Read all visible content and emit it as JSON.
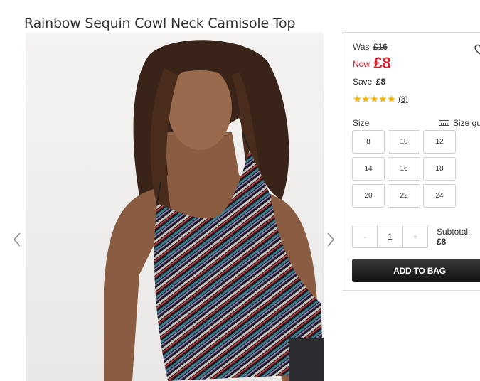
{
  "product": {
    "title": "Rainbow Sequin Cowl Neck Camisole Top"
  },
  "pricing": {
    "was_label": "Was",
    "was_price": "£16",
    "now_label": "Now",
    "now_price": "£8",
    "save_label": "Save",
    "save_amount": "£8",
    "price_color": "#d4202a"
  },
  "rating": {
    "stars": "★★★★★",
    "count": "(8)",
    "star_color": "#f2b300"
  },
  "size": {
    "label": "Size",
    "guide_label": "Size gui",
    "options": [
      "8",
      "10",
      "12",
      "14",
      "16",
      "18",
      "20",
      "22",
      "24"
    ]
  },
  "quantity": {
    "minus": "-",
    "value": "1",
    "plus": "+"
  },
  "subtotal": {
    "label": "Subtotal:",
    "value": "£8"
  },
  "actions": {
    "add_to_bag": "ADD TO BAG"
  },
  "icons": {
    "wishlist": "heart-icon",
    "prev": "chevron-left-icon",
    "next": "chevron-right-icon",
    "size_guide": "ruler-icon"
  }
}
